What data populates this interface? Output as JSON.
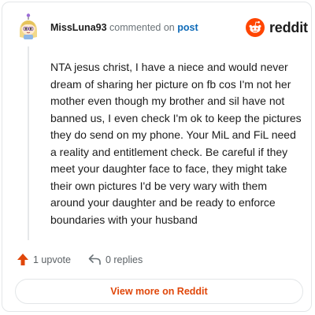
{
  "brand": {
    "name": "reddit",
    "accent_color": "#ff4500",
    "icon": "reddit-logo-icon"
  },
  "comment": {
    "author": "MissLuna93",
    "action_text": "commented on",
    "target_link": "post",
    "avatar": "snoo-avatar-icon",
    "body": "NTA jesus christ, I have a niece and would never dream of sharing her picture on fb cos I'm not her mother even though my brother and sil have not banned us, I even check I'm ok to keep the pictures they do send on my phone. Your MiL and FiL need a reality and entitlement check. Be careful if they meet your daughter face to face, they might take their own pictures I'd be very wary with them around your daughter and be ready to enforce boundaries with your husband"
  },
  "actions": {
    "upvotes": "1 upvote",
    "upvote_icon": "upvote-arrow-icon",
    "upvote_color": "#e0470a",
    "replies": "0 replies",
    "reply_icon": "reply-icon"
  },
  "footer": {
    "view_more_label": "View more on Reddit",
    "view_more_color": "#e0470a"
  }
}
